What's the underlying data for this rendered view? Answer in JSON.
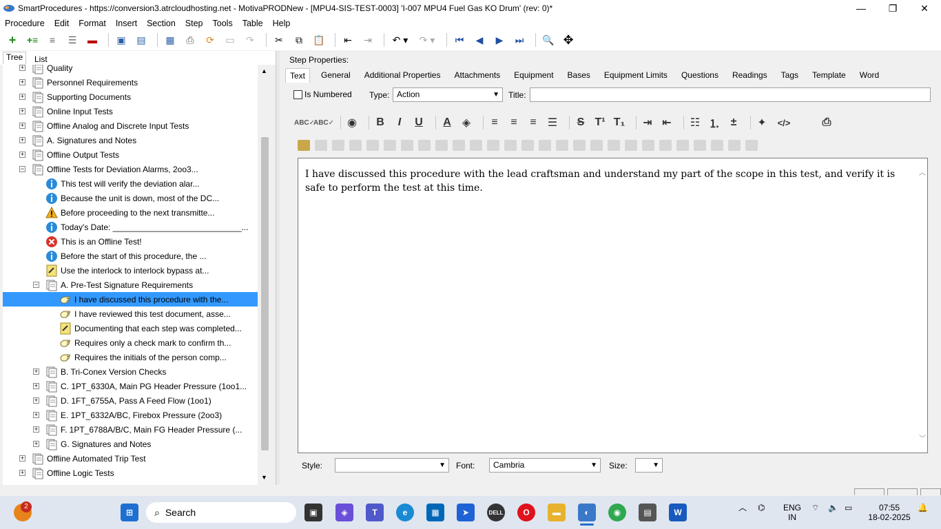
{
  "window": {
    "title": "SmartProcedures - https://conversion3.atrcloudhosting.net - MotivaPRODNew - [MPU4-SIS-TEST-0003] 'I-007 MPU4 Fuel Gas KO Drum' (rev: 0)*",
    "minimize": "—",
    "maximize": "❐",
    "close": "✕"
  },
  "menu": [
    "Procedure",
    "Edit",
    "Format",
    "Insert",
    "Section",
    "Step",
    "Tools",
    "Table",
    "Help"
  ],
  "left_tabs": [
    "Tree",
    "List"
  ],
  "tree": [
    {
      "label": "Quality",
      "level": 0,
      "expander": "+",
      "icon": "section-icon"
    },
    {
      "label": "Personnel Requirements",
      "level": 0,
      "expander": "+",
      "icon": "section-icon"
    },
    {
      "label": "Supporting Documents",
      "level": 0,
      "expander": "+",
      "icon": "section-icon"
    },
    {
      "label": "Online Input Tests",
      "level": 0,
      "expander": "+",
      "icon": "section-icon"
    },
    {
      "label": "Offline Analog and Discrete Input Tests",
      "level": 0,
      "expander": "+",
      "icon": "section-icon"
    },
    {
      "label": "A. Signatures and Notes",
      "level": 0,
      "expander": "+",
      "icon": "section-icon"
    },
    {
      "label": "Offline Output Tests",
      "level": 0,
      "expander": "+",
      "icon": "section-icon"
    },
    {
      "label": "Offline Tests for Deviation Alarms, 2oo3...",
      "level": 0,
      "expander": "−",
      "icon": "section-icon"
    },
    {
      "label": "This test will verify the deviation alar...",
      "level": 1,
      "expander": "",
      "icon": "info-icon"
    },
    {
      "label": "Because the unit is down, most of the DC...",
      "level": 1,
      "expander": "",
      "icon": "info-icon"
    },
    {
      "label": "Before proceeding to the next transmitte...",
      "level": 1,
      "expander": "",
      "icon": "warning-icon"
    },
    {
      "label": "Today's Date: ____________________________...",
      "level": 1,
      "expander": "",
      "icon": "info-icon"
    },
    {
      "label": "This is an Offline Test!",
      "level": 1,
      "expander": "",
      "icon": "error-icon"
    },
    {
      "label": "Before the start of this procedure, the ...",
      "level": 1,
      "expander": "",
      "icon": "info-icon"
    },
    {
      "label": "Use the interlock to interlock bypass at...",
      "level": 1,
      "expander": "",
      "icon": "note-icon"
    },
    {
      "label": "A. Pre-Test Signature Requirements",
      "level": 1,
      "expander": "−",
      "icon": "section-icon"
    },
    {
      "label": "I have discussed this procedure with the...",
      "level": 2,
      "expander": "",
      "icon": "hand-icon",
      "selected": true
    },
    {
      "label": "I have reviewed this test document, asse...",
      "level": 2,
      "expander": "",
      "icon": "hand-icon"
    },
    {
      "label": "Documenting that each step was completed...",
      "level": 2,
      "expander": "",
      "icon": "note-icon"
    },
    {
      "label": "Requires only a check mark to confirm th...",
      "level": 2,
      "expander": "",
      "icon": "hand-icon"
    },
    {
      "label": "Requires the initials of the person comp...",
      "level": 2,
      "expander": "",
      "icon": "hand-icon"
    },
    {
      "label": "B. Tri-Conex Version Checks",
      "level": 1,
      "expander": "+",
      "icon": "section-icon"
    },
    {
      "label": "C. 1PT_6330A, Main PG Header Pressure (1oo1...",
      "level": 1,
      "expander": "+",
      "icon": "section-icon"
    },
    {
      "label": "D. 1FT_6755A, Pass A Feed Flow (1oo1)",
      "level": 1,
      "expander": "+",
      "icon": "section-icon"
    },
    {
      "label": "E. 1PT_6332A/BC, Firebox Pressure (2oo3)",
      "level": 1,
      "expander": "+",
      "icon": "section-icon"
    },
    {
      "label": "F. 1PT_6788A/B/C, Main FG Header Pressure (...",
      "level": 1,
      "expander": "+",
      "icon": "section-icon"
    },
    {
      "label": "G. Signatures and Notes",
      "level": 1,
      "expander": "+",
      "icon": "section-icon"
    },
    {
      "label": "Offline Automated Trip Test",
      "level": 0,
      "expander": "+",
      "icon": "section-icon"
    },
    {
      "label": "Offline Logic Tests",
      "level": 0,
      "expander": "+",
      "icon": "section-icon"
    }
  ],
  "step_properties": {
    "label": "Step Properties:",
    "tabs": [
      "Text",
      "General",
      "Additional Properties",
      "Attachments",
      "Equipment",
      "Bases",
      "Equipment Limits",
      "Questions",
      "Readings",
      "Tags",
      "Template",
      "Word"
    ],
    "is_numbered_label": "Is Numbered",
    "type_label": "Type:",
    "type_value": "Action",
    "title_label": "Title:",
    "title_value": "",
    "editor_text": "I have discussed this procedure with the lead craftsman and understand my part of the scope in this test, and verify it is safe to perform the test at this time.",
    "style_label": "Style:",
    "style_value": "",
    "font_label": "Font:",
    "font_value": "Cambria",
    "size_label": "Size:",
    "size_value": ""
  },
  "taskbar": {
    "search_placeholder": "Search",
    "notification_count": "2",
    "lang_line1": "ENG",
    "lang_line2": "IN",
    "time": "07:55",
    "date": "18-02-2025"
  }
}
